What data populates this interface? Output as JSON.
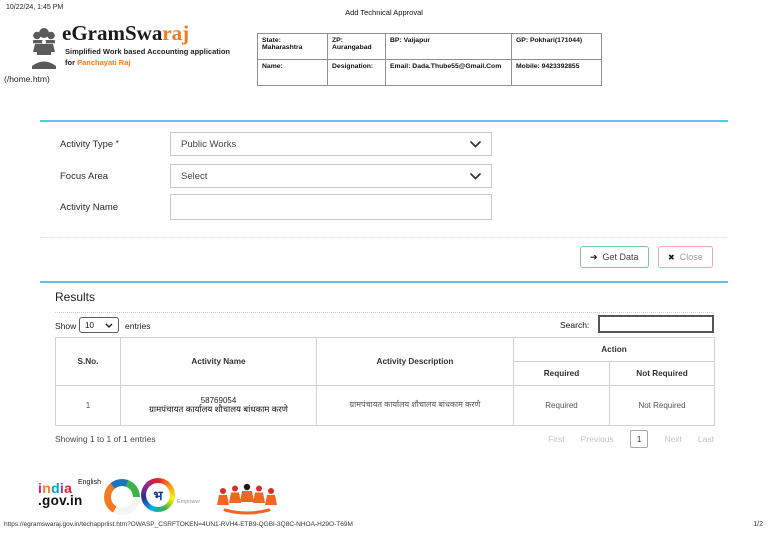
{
  "page": {
    "timestamp": "10/22/24, 1:45 PM",
    "title": "Add Technical Approval",
    "url": "https://egramswaraj.gov.in/techapprlist.htm?OWASP_CSRFTOKEN=4UN1-RVH4-ETB9-QGBI-3Q8C-NHOA-H29O-T69M",
    "page_indicator": "1/2"
  },
  "header": {
    "app_name_prefix": "eGramSwa",
    "app_name_accent": "raj",
    "tagline": "Simplified Work based Accounting application",
    "tagline_for": "for ",
    "tagline_accent": "Panchayati Raj",
    "home_link": "(/home.htm)",
    "info_rows": [
      {
        "cells": [
          "State: Maharashtra",
          "ZP: Aurangabad",
          "BP: Vaijapur",
          "GP: Pokhari(171044)"
        ]
      },
      {
        "cells": [
          "Name:",
          "Designation:",
          "Email: Dada.Thube55@Gmail.Com",
          "Mobile: 9423392855"
        ]
      }
    ]
  },
  "form": {
    "activity_type_label": "Activity Type ",
    "required_marker": "*",
    "activity_type_value": "Public Works",
    "focus_area_label": "Focus Area",
    "focus_area_value": "Select",
    "activity_name_label": "Activity Name",
    "activity_name_value": "",
    "get_data_label": "Get Data",
    "close_label": "Close"
  },
  "icons": {
    "get_data_arrow": "➔",
    "close_x": "✖"
  },
  "results": {
    "heading": "Results",
    "show_label": "Show",
    "page_size": "10",
    "entries_label": "entries",
    "search_label": "Search:",
    "search_value": "",
    "table": {
      "col_sno": "S.No.",
      "col_activity_name": "Activity Name",
      "col_activity_description": "Activity Description",
      "col_action": "Action",
      "col_required": "Required",
      "col_not_required": "Not Required",
      "rows": [
        {
          "sno": "1",
          "code": "58769054",
          "name": "ग्रामपंचायत कार्यालय शौचालय बांधकाम करणे",
          "description": "ग्रामपंचायत कार्यालय शौचालय बांधकाम करणे",
          "required_label": "Required",
          "not_required_label": "Not Required"
        }
      ]
    },
    "summary": "Showing 1 to 1 of 1 entries",
    "pagination": {
      "first": "First",
      "previous": "Previous",
      "current": "1",
      "next": "Next",
      "last": "Last"
    }
  },
  "footer": {
    "india_letters": [
      "i",
      "n",
      "d",
      "i",
      "a"
    ],
    "india_domain": ".gov.in",
    "english_label": "English",
    "bhashini_char": "भ",
    "empower_label": "Empower"
  },
  "colors": {
    "accent_orange": "#f47b20",
    "line_cyan": "#5fc4e7",
    "get_data_green": "#7cc99c",
    "close_red": "#f2a9a9"
  }
}
